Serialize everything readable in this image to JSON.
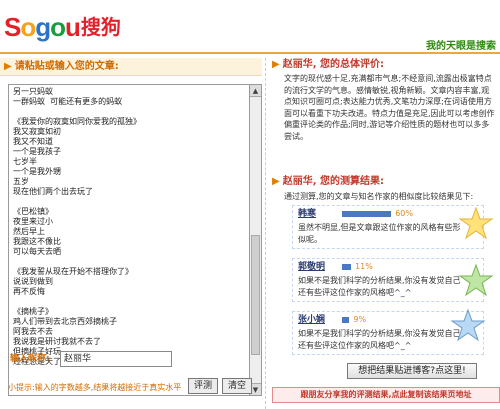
{
  "header": {
    "logo_letters": [
      "S",
      "o",
      "g",
      "o",
      "u"
    ],
    "logo_cn": "搜狗",
    "tagline": "我的天眼是搜索"
  },
  "left": {
    "panel_title": "请粘贴或输入您的文章:",
    "article_text": "另一只蚂蚁\n一群蚂蚁  可能还有更多的蚂蚁\n\n《我爱你的寂寞如同你爱我的孤独》\n我又寂寞如初\n我又不知道\n一个是我孩子\n七岁半\n一个是我外甥\n五岁\n现在他们两个出去玩了\n\n《巴松镇》\n夜里来过小\n然后早上\n我跟这不像比\n可以每天去晒\n\n《我发誓从现在开始不搭理你了》\n说说到做到\n再不反悔\n\n《摘桃子》\n鸡人们带到去北京西郊摘桃子\n阿我去不去\n我说我是研讨我就不去了\n但摘桃子好玩\n过程总是天了",
    "nickname_label": "输入昵称:",
    "nickname_value": "赵丽华",
    "tip": "小提示:输入的字数越多,结果将越接近于真实水平",
    "eval_button": "评测",
    "clear_button": "清空",
    "scroll_up": "▲",
    "scroll_down": "▼"
  },
  "right": {
    "eval_title": "赵丽华, 您的总体评价:",
    "eval_text": "文字的现代感十足,充满都市气息;不经意间,流露出极富特点的流行文学的气息。感情敏锐,视角新颖。文章内容丰富,观点知识可圈可点;表达能力优秀,文笔功力深厚;在词语使用方面可以看重下功夫改进。特点力值是充足,因此可以考虑创作偏重评论类的作品;同时,游记等介绍性质的题材也可以多多尝试。",
    "result_title": "赵丽华, 您的测算结果:",
    "result_sub": "通过测算,您的文章与知名作家的相似度比较结果见下:",
    "results": [
      {
        "name": "韩寒",
        "percent": "60%",
        "value": 60,
        "text": "虽然不明显,但是文章跟这位作家的风格有些形似呢。"
      },
      {
        "name": "郭敬明",
        "percent": "11%",
        "value": 11,
        "text": "如果不是我们科学的分析结果,你没有发觉自己还有些评这位作家的风格吧^_^"
      },
      {
        "name": "张小娴",
        "percent": "9%",
        "value": 9,
        "text": "如果不是我们科学的分析结果,你没有发觉自己还有些评这位作家的风格吧^_^"
      }
    ],
    "share_button": "想把结果贴进博客?点这里!",
    "share_note": "跟朋友分享我的评测结果,点此复制该结果页地址"
  },
  "colors": {
    "accent_orange": "#d16a00",
    "title_red": "#c0392b",
    "bar_blue": "#4a78c3",
    "tagline_green": "#2f8a10"
  },
  "icons": [
    "arrow-icon",
    "star-icon"
  ]
}
